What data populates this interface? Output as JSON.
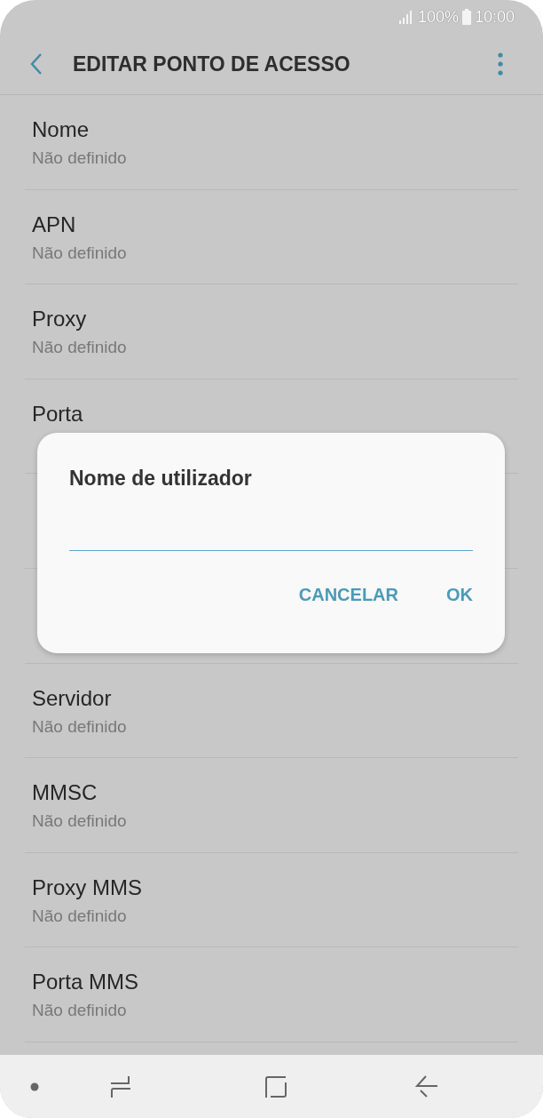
{
  "status_bar": {
    "battery": "100%",
    "time": "10:00"
  },
  "toolbar": {
    "title": "EDITAR PONTO DE ACESSO"
  },
  "settings": [
    {
      "title": "Nome",
      "value": "Não definido"
    },
    {
      "title": "APN",
      "value": "Não definido"
    },
    {
      "title": "Proxy",
      "value": "Não definido"
    },
    {
      "title": "Porta"
    },
    {
      "covered": true
    },
    {
      "covered": true
    },
    {
      "title": "Servidor",
      "value": "Não definido"
    },
    {
      "title": "MMSC",
      "value": "Não definido"
    },
    {
      "title": "Proxy MMS",
      "value": "Não definido"
    },
    {
      "title": "Porta MMS",
      "value": "Não definido"
    }
  ],
  "dialog": {
    "title": "Nome de utilizador",
    "buttons": [
      "CANCELAR",
      "OK"
    ]
  }
}
